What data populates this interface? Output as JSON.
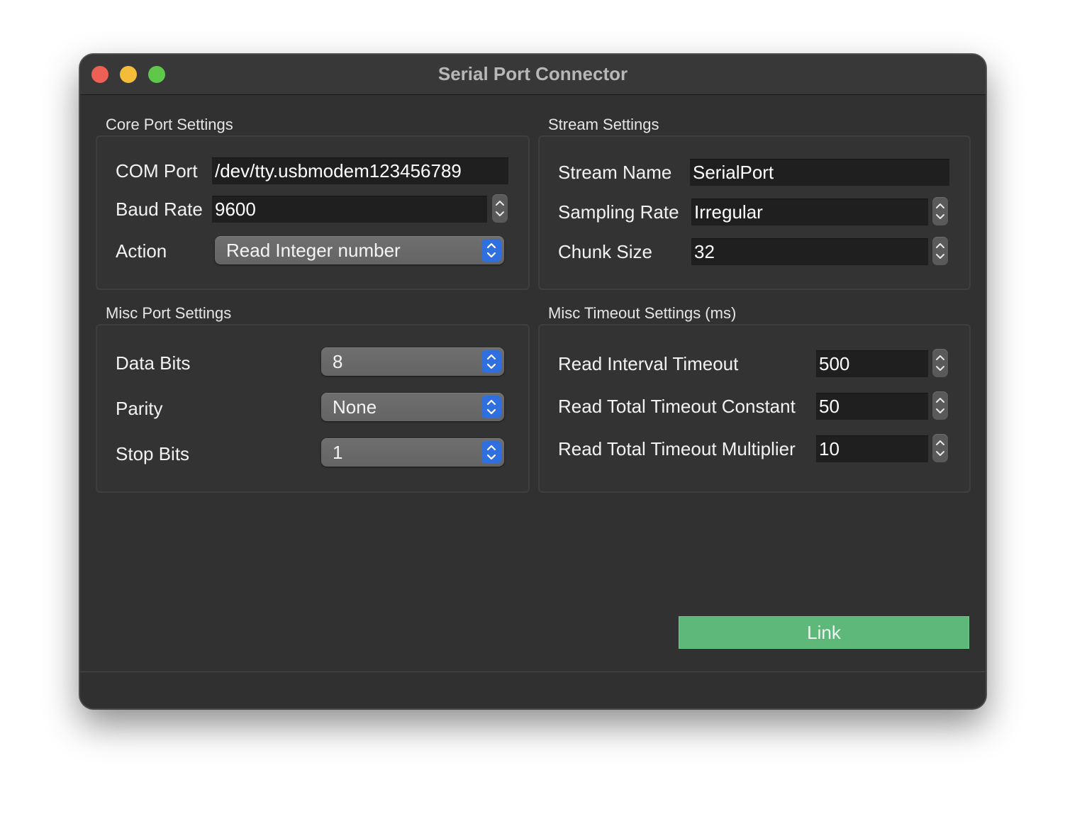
{
  "window": {
    "title": "Serial Port Connector",
    "controls": [
      "close",
      "minimize",
      "zoom"
    ]
  },
  "core_port_settings": {
    "title": "Core Port Settings",
    "com_port": {
      "label": "COM Port",
      "value": "/dev/tty.usbmodem123456789"
    },
    "baud_rate": {
      "label": "Baud Rate",
      "value": "9600"
    },
    "action": {
      "label": "Action",
      "selected": "Read Integer number"
    }
  },
  "stream_settings": {
    "title": "Stream Settings",
    "stream_name": {
      "label": "Stream Name",
      "value": "SerialPort"
    },
    "sampling_rate": {
      "label": "Sampling Rate",
      "value": "Irregular"
    },
    "chunk_size": {
      "label": "Chunk Size",
      "value": "32"
    }
  },
  "misc_port_settings": {
    "title": "Misc Port Settings",
    "data_bits": {
      "label": "Data Bits",
      "selected": "8"
    },
    "parity": {
      "label": "Parity",
      "selected": "None"
    },
    "stop_bits": {
      "label": "Stop Bits",
      "selected": "1"
    }
  },
  "misc_timeout_settings": {
    "title": "Misc Timeout Settings (ms)",
    "read_interval_timeout": {
      "label": "Read Interval Timeout",
      "value": "500"
    },
    "read_total_timeout_constant": {
      "label": "Read Total Timeout Constant",
      "value": "50"
    },
    "read_total_timeout_multiplier": {
      "label": "Read Total Timeout Multiplier",
      "value": "10"
    }
  },
  "link_button": {
    "label": "Link"
  },
  "colors": {
    "window_bg": "#313131",
    "field_bg": "#1f1f1f",
    "popup_bg": "#686868",
    "popup_accent": "#2f6fe0",
    "link_button_bg": "#5db87a",
    "close": "#ee5f56",
    "minimize": "#f3bd3a",
    "zoom": "#5fc84b"
  }
}
